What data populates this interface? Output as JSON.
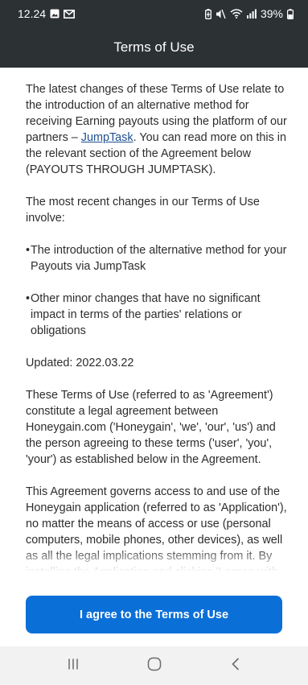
{
  "status_bar": {
    "time": "12.24",
    "battery": "39%",
    "left_icons": [
      "gallery-icon",
      "gmail-icon"
    ],
    "right_icons": [
      "battery-saver-icon",
      "mute-icon",
      "wifi-icon",
      "signal-icon",
      "battery-icon"
    ]
  },
  "header": {
    "title": "Terms of Use"
  },
  "content": {
    "p1_before": "The latest changes of these Terms of Use relate to the introduction of an alternative method for receiving Earning payouts using the platform of our partners – ",
    "p1_link": "JumpTask",
    "p1_after": ". You can read more on this in the relevant section of the Agreement below (PAYOUTS THROUGH JUMPTASK).",
    "p2": "The most recent changes in our Terms of Use involve:",
    "bullets": [
      "The introduction of the alternative method for your Payouts via JumpTask",
      "Other minor changes that have no significant impact in terms of the parties' relations or obligations"
    ],
    "updated": "Updated: 2022.03.22",
    "p3": "These Terms of Use (referred to as 'Agreement') constitute a legal agreement between Honeygain.com ('Honeygain', 'we', 'our', 'us') and the person agreeing to these terms ('user', 'you', 'your') as established below in the Agreement.",
    "p4": "This Agreement governs access to and use of the Honeygain application (referred to as 'Application'), no matter the means of access or use (personal computers, mobile phones, other devices), as well as all the legal implications stemming from it. By installing the Application and clicking 'I agree with Terms of Use', you confirm that you have read and express your consent to the terms of this"
  },
  "button": {
    "agree_label": "I agree to the Terms of Use"
  },
  "nav": {
    "icons": [
      "recents-icon",
      "home-icon",
      "back-icon"
    ]
  },
  "colors": {
    "header_bg": "#2c3134",
    "button_bg": "#0b6fd8",
    "link": "#1f4f8f",
    "nav_bg": "#f2f2f2"
  }
}
